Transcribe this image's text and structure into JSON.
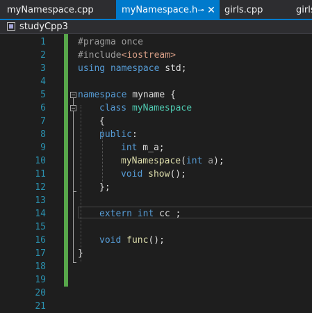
{
  "tabs": [
    {
      "label": "myNamespace.cpp"
    },
    {
      "label": "myNamespace.h",
      "pin": "⊸",
      "close": "✕"
    },
    {
      "label": "girls.cpp"
    },
    {
      "label": "girls"
    }
  ],
  "navbar": {
    "project": "studyCpp3"
  },
  "editor": {
    "line_numbers": [
      "1",
      "2",
      "3",
      "4",
      "5",
      "6",
      "7",
      "8",
      "9",
      "10",
      "11",
      "12",
      "13",
      "14",
      "15",
      "16",
      "17",
      "18",
      "19",
      "20",
      "21"
    ],
    "code": {
      "l1": {
        "a": "#pragma once"
      },
      "l2": {
        "a": "#include",
        "b": "<iostream>"
      },
      "l3": {
        "a": "using",
        "b": " ",
        "c": "namespace",
        "d": " std;"
      },
      "l5": {
        "a": "namespace",
        "b": " myname {"
      },
      "l6": {
        "a": "class",
        "b": " ",
        "c": "myNamespace"
      },
      "l7": {
        "a": "{"
      },
      "l8": {
        "a": "public",
        "b": ":"
      },
      "l9": {
        "a": "int",
        "b": " m_a;"
      },
      "l10": {
        "a": "myNamespace",
        "b": "(",
        "c": "int",
        "d": " ",
        "e": "a",
        "f": ");"
      },
      "l11": {
        "a": "void",
        "b": " ",
        "c": "show",
        "d": "();"
      },
      "l12": {
        "a": "};"
      },
      "l14": {
        "a": "extern",
        "b": " ",
        "c": "int",
        "d": " cc ;"
      },
      "l16": {
        "a": "void",
        "b": " ",
        "c": "func",
        "d": "();"
      },
      "l17": {
        "a": "}"
      }
    }
  }
}
